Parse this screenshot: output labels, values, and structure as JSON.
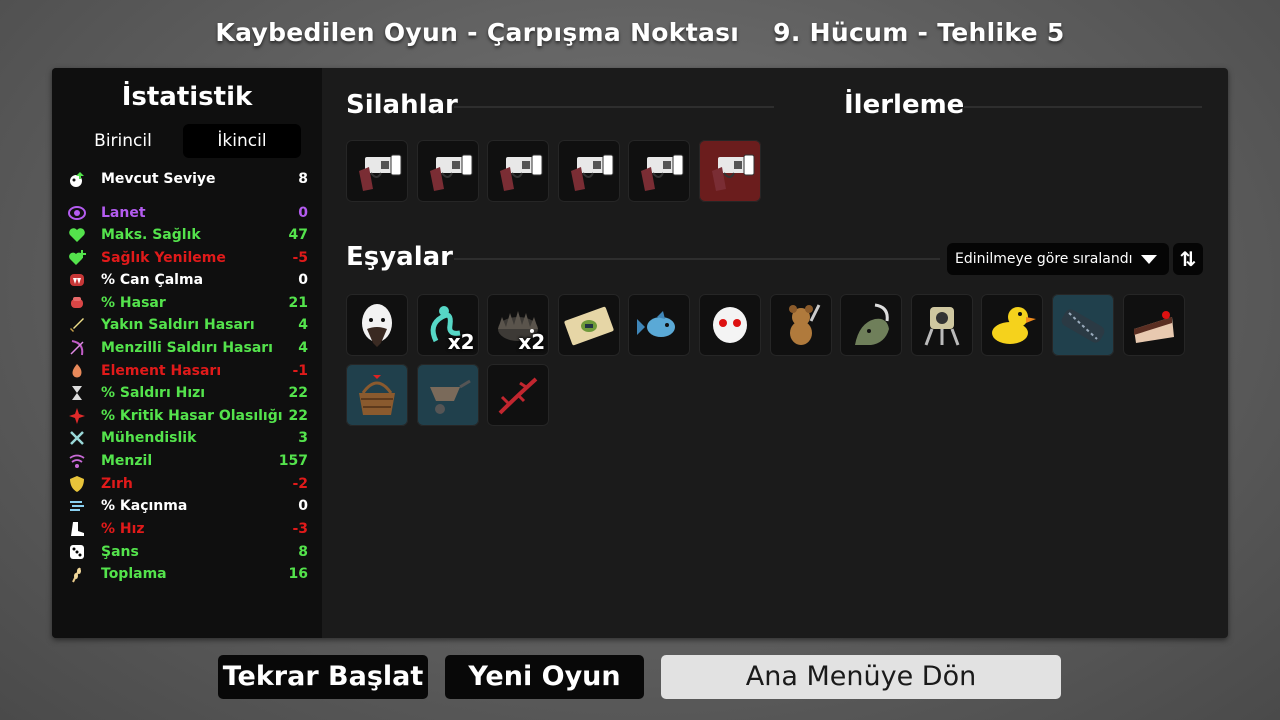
{
  "header": {
    "run_title": "Kaybedilen Oyun - Çarpışma Noktası",
    "wave_info": "9. Hücum - Tehlike 5"
  },
  "stats": {
    "title": "İstatistik",
    "tabs": {
      "primary": "Birincil",
      "secondary": "İkincil"
    },
    "level": {
      "label": "Mevcut Seviye",
      "value": "8",
      "icon": "level-up-icon",
      "color": "#ffffff"
    },
    "rows": [
      {
        "label": "Lanet",
        "value": "0",
        "icon": "curse-eye-icon",
        "color": "#b45cf0"
      },
      {
        "label": "Maks. Sağlık",
        "value": "47",
        "icon": "heart-icon",
        "color": "#54e34c"
      },
      {
        "label": "Sağlık Yenileme",
        "value": "-5",
        "icon": "heart-plus-icon",
        "color": "#e01a1a"
      },
      {
        "label": "% Can Çalma",
        "value": "0",
        "icon": "fangs-icon",
        "color": "#ffffff"
      },
      {
        "label": "% Hasar",
        "value": "21",
        "icon": "fist-icon",
        "color": "#54e34c"
      },
      {
        "label": "Yakın Saldırı Hasarı",
        "value": "4",
        "icon": "sword-icon",
        "color": "#54e34c"
      },
      {
        "label": "Menzilli Saldırı Hasarı",
        "value": "4",
        "icon": "bow-icon",
        "color": "#54e34c"
      },
      {
        "label": "Element Hasarı",
        "value": "-1",
        "icon": "flame-icon",
        "color": "#e01a1a"
      },
      {
        "label": "% Saldırı Hızı",
        "value": "22",
        "icon": "hourglass-icon",
        "color": "#54e34c"
      },
      {
        "label": "% Kritik Hasar Olasılığı",
        "value": "22",
        "icon": "crit-burst-icon",
        "color": "#54e34c"
      },
      {
        "label": "Mühendislik",
        "value": "3",
        "icon": "wrench-icon",
        "color": "#54e34c"
      },
      {
        "label": "Menzil",
        "value": "157",
        "icon": "range-waves-icon",
        "color": "#54e34c"
      },
      {
        "label": "Zırh",
        "value": "-2",
        "icon": "shield-icon",
        "color": "#e01a1a"
      },
      {
        "label": "% Kaçınma",
        "value": "0",
        "icon": "dodge-icon",
        "color": "#ffffff"
      },
      {
        "label": "% Hız",
        "value": "-3",
        "icon": "boot-icon",
        "color": "#e01a1a"
      },
      {
        "label": "Şans",
        "value": "8",
        "icon": "dice-icon",
        "color": "#54e34c"
      },
      {
        "label": "Toplama",
        "value": "16",
        "icon": "harvest-wheat-icon",
        "color": "#54e34c"
      }
    ]
  },
  "weapons": {
    "title": "Silahlar",
    "slots": [
      {
        "name": "revolver-icon",
        "tier": "common"
      },
      {
        "name": "revolver-icon",
        "tier": "common"
      },
      {
        "name": "revolver-icon",
        "tier": "common"
      },
      {
        "name": "revolver-icon",
        "tier": "common"
      },
      {
        "name": "revolver-icon",
        "tier": "common"
      },
      {
        "name": "revolver-icon",
        "tier": "legendary"
      }
    ]
  },
  "progress": {
    "title": "İlerleme"
  },
  "items": {
    "title": "Eşyalar",
    "sort_label": "Edinilmeye göre sıralandı",
    "sort_toggle": "⇅",
    "slots": [
      {
        "name": "bearded-egg-icon",
        "qty": "",
        "tier": "common"
      },
      {
        "name": "alien-tentacle-icon",
        "qty": "x2",
        "tier": "common"
      },
      {
        "name": "hedgehog-icon",
        "qty": "x2",
        "tier": "common"
      },
      {
        "name": "banknote-icon",
        "qty": "",
        "tier": "common"
      },
      {
        "name": "fish-icon",
        "qty": "",
        "tier": "common"
      },
      {
        "name": "ghost-mask-icon",
        "qty": "",
        "tier": "common"
      },
      {
        "name": "bear-toy-icon",
        "qty": "",
        "tier": "common"
      },
      {
        "name": "scythe-creature-icon",
        "qty": "",
        "tier": "common"
      },
      {
        "name": "turret-icon",
        "qty": "",
        "tier": "common"
      },
      {
        "name": "rubber-duck-icon",
        "qty": "",
        "tier": "common"
      },
      {
        "name": "barrel-scope-icon",
        "qty": "",
        "tier": "rare"
      },
      {
        "name": "cake-slice-icon",
        "qty": "",
        "tier": "common"
      },
      {
        "name": "gift-basket-icon",
        "qty": "",
        "tier": "rare"
      },
      {
        "name": "wheelbarrow-icon",
        "qty": "",
        "tier": "rare"
      },
      {
        "name": "thorn-branch-icon",
        "qty": "",
        "tier": "common"
      }
    ]
  },
  "buttons": {
    "restart": "Tekrar Başlat",
    "new_game": "Yeni Oyun",
    "main_menu": "Ana Menüye Dön"
  }
}
